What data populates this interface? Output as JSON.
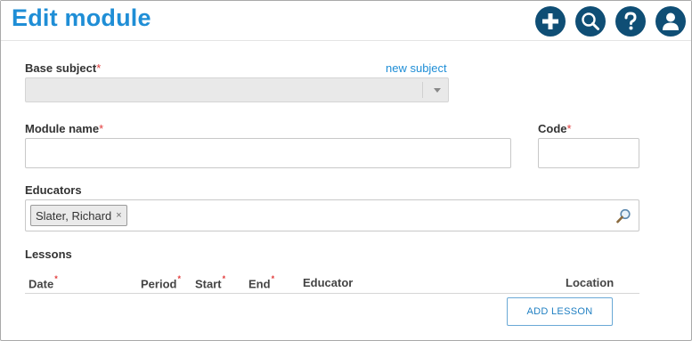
{
  "header": {
    "title": "Edit module",
    "actions": [
      {
        "name": "add",
        "icon": "plus-icon"
      },
      {
        "name": "search",
        "icon": "search-icon"
      },
      {
        "name": "help",
        "icon": "question-icon"
      },
      {
        "name": "account",
        "icon": "user-icon"
      }
    ],
    "action_color": "#0f4e75",
    "title_color": "#1f8ed6"
  },
  "form": {
    "base_subject": {
      "label": "Base subject",
      "required_mark": "*",
      "value": "",
      "new_link": "new subject"
    },
    "module_name": {
      "label": "Module name",
      "required_mark": "*",
      "value": ""
    },
    "code": {
      "label": "Code",
      "required_mark": "*",
      "value": ""
    },
    "educators": {
      "label": "Educators",
      "tags": [
        {
          "label": "Slater, Richard",
          "remove": "×"
        }
      ]
    }
  },
  "lessons": {
    "label": "Lessons",
    "columns": [
      {
        "label": "Date",
        "required_mark": "*"
      },
      {
        "label": "Period",
        "required_mark": "*"
      },
      {
        "label": "Start",
        "required_mark": "*"
      },
      {
        "label": "End",
        "required_mark": "*"
      },
      {
        "label": "Educator",
        "required_mark": ""
      },
      {
        "label": "Location",
        "required_mark": ""
      }
    ],
    "rows": [],
    "add_button": "ADD LESSON"
  }
}
